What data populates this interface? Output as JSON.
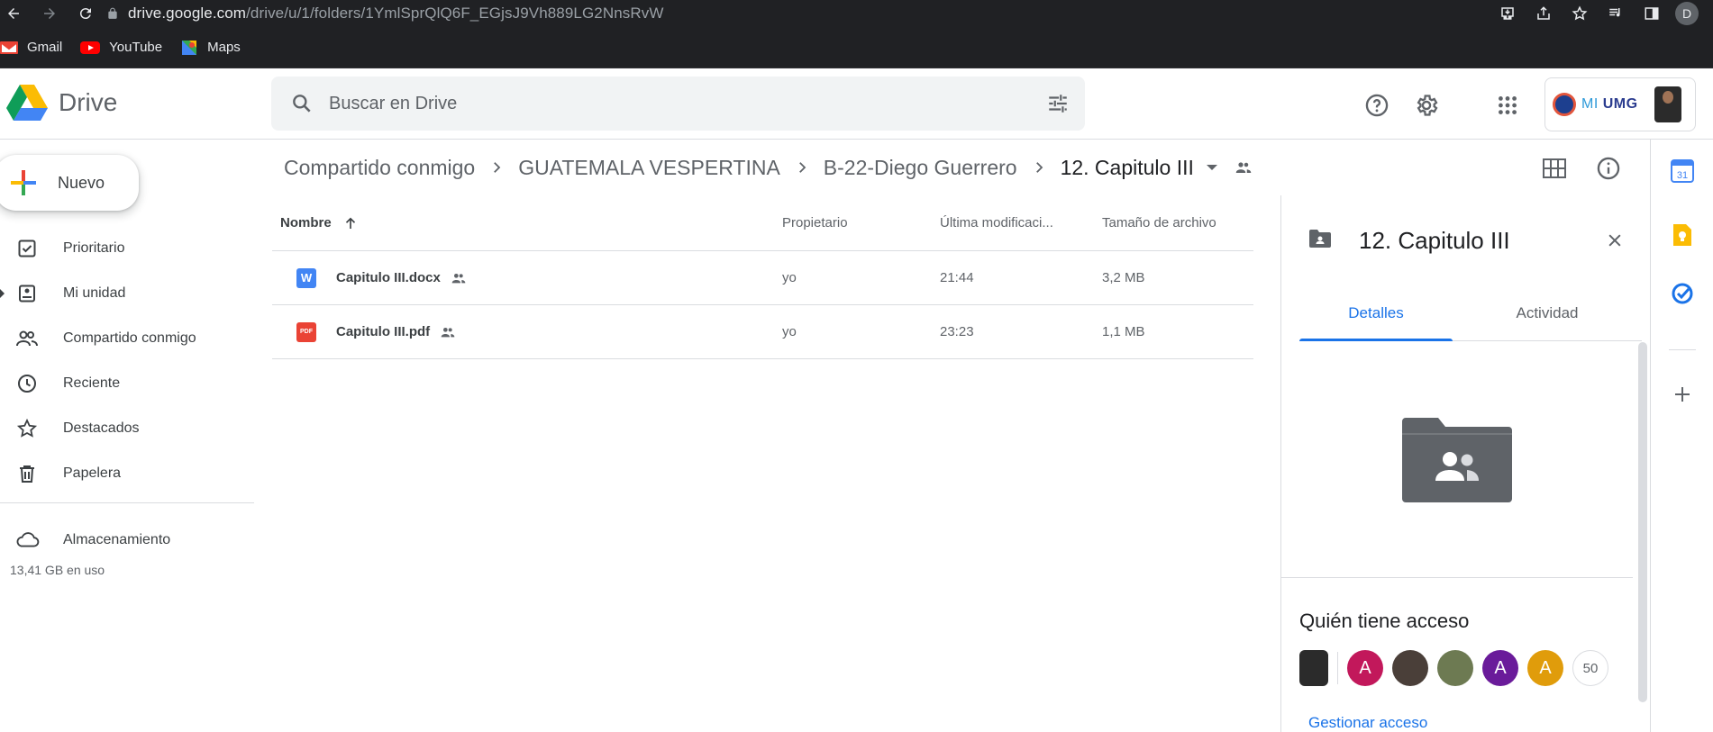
{
  "browser": {
    "url_host": "drive.google.com",
    "url_path": "/drive/u/1/folders/1YmlSprQlQ6F_EGjsJ9Vh889LG2NnsRvW",
    "profile_initial": "D"
  },
  "bookmarks": [
    {
      "label": "Gmail",
      "icon": "gmail-icon"
    },
    {
      "label": "YouTube",
      "icon": "youtube-icon"
    },
    {
      "label": "Maps",
      "icon": "maps-icon"
    }
  ],
  "header": {
    "app_name": "Drive",
    "search_placeholder": "Buscar en Drive",
    "account_brand_prefix": "MI",
    "account_brand": "UMG"
  },
  "sidebar": {
    "new_label": "Nuevo",
    "items": [
      {
        "label": "Prioritario",
        "icon": "check-box-icon"
      },
      {
        "label": "Mi unidad",
        "icon": "my-drive-icon"
      },
      {
        "label": "Compartido conmigo",
        "icon": "people-icon"
      },
      {
        "label": "Reciente",
        "icon": "clock-icon"
      },
      {
        "label": "Destacados",
        "icon": "star-icon"
      },
      {
        "label": "Papelera",
        "icon": "trash-icon"
      }
    ],
    "storage_label": "Almacenamiento",
    "storage_used": "13,41 GB en uso"
  },
  "breadcrumb": [
    "Compartido conmigo",
    "GUATEMALA VESPERTINA",
    "B-22-Diego Guerrero",
    "12. Capitulo III"
  ],
  "filelist": {
    "columns": {
      "name": "Nombre",
      "owner": "Propietario",
      "modified": "Última modificaci...",
      "size": "Tamaño de archivo"
    },
    "rows": [
      {
        "name": "Capitulo III.docx",
        "type": "word",
        "type_label": "W",
        "owner": "yo",
        "modified": "21:44",
        "size": "3,2 MB"
      },
      {
        "name": "Capitulo III.pdf",
        "type": "pdf",
        "type_label": "PDF",
        "owner": "yo",
        "modified": "23:23",
        "size": "1,1 MB"
      }
    ]
  },
  "details": {
    "title": "12. Capitulo III",
    "tabs": [
      "Detalles",
      "Actividad"
    ],
    "active_tab": "Detalles",
    "access_title": "Quién tiene acceso",
    "access_avatars": [
      {
        "type": "photo"
      },
      {
        "type": "letter",
        "letter": "A",
        "color": "#c2185b"
      },
      {
        "type": "photo"
      },
      {
        "type": "photo"
      },
      {
        "type": "letter",
        "letter": "A",
        "color": "#6a1b9a"
      },
      {
        "type": "letter",
        "letter": "A",
        "color": "#e09c0b"
      }
    ],
    "access_count": "50",
    "manage_label": "Gestionar acceso"
  },
  "colors": {
    "accent": "#1a73e8",
    "chrome_bg": "#202124"
  }
}
